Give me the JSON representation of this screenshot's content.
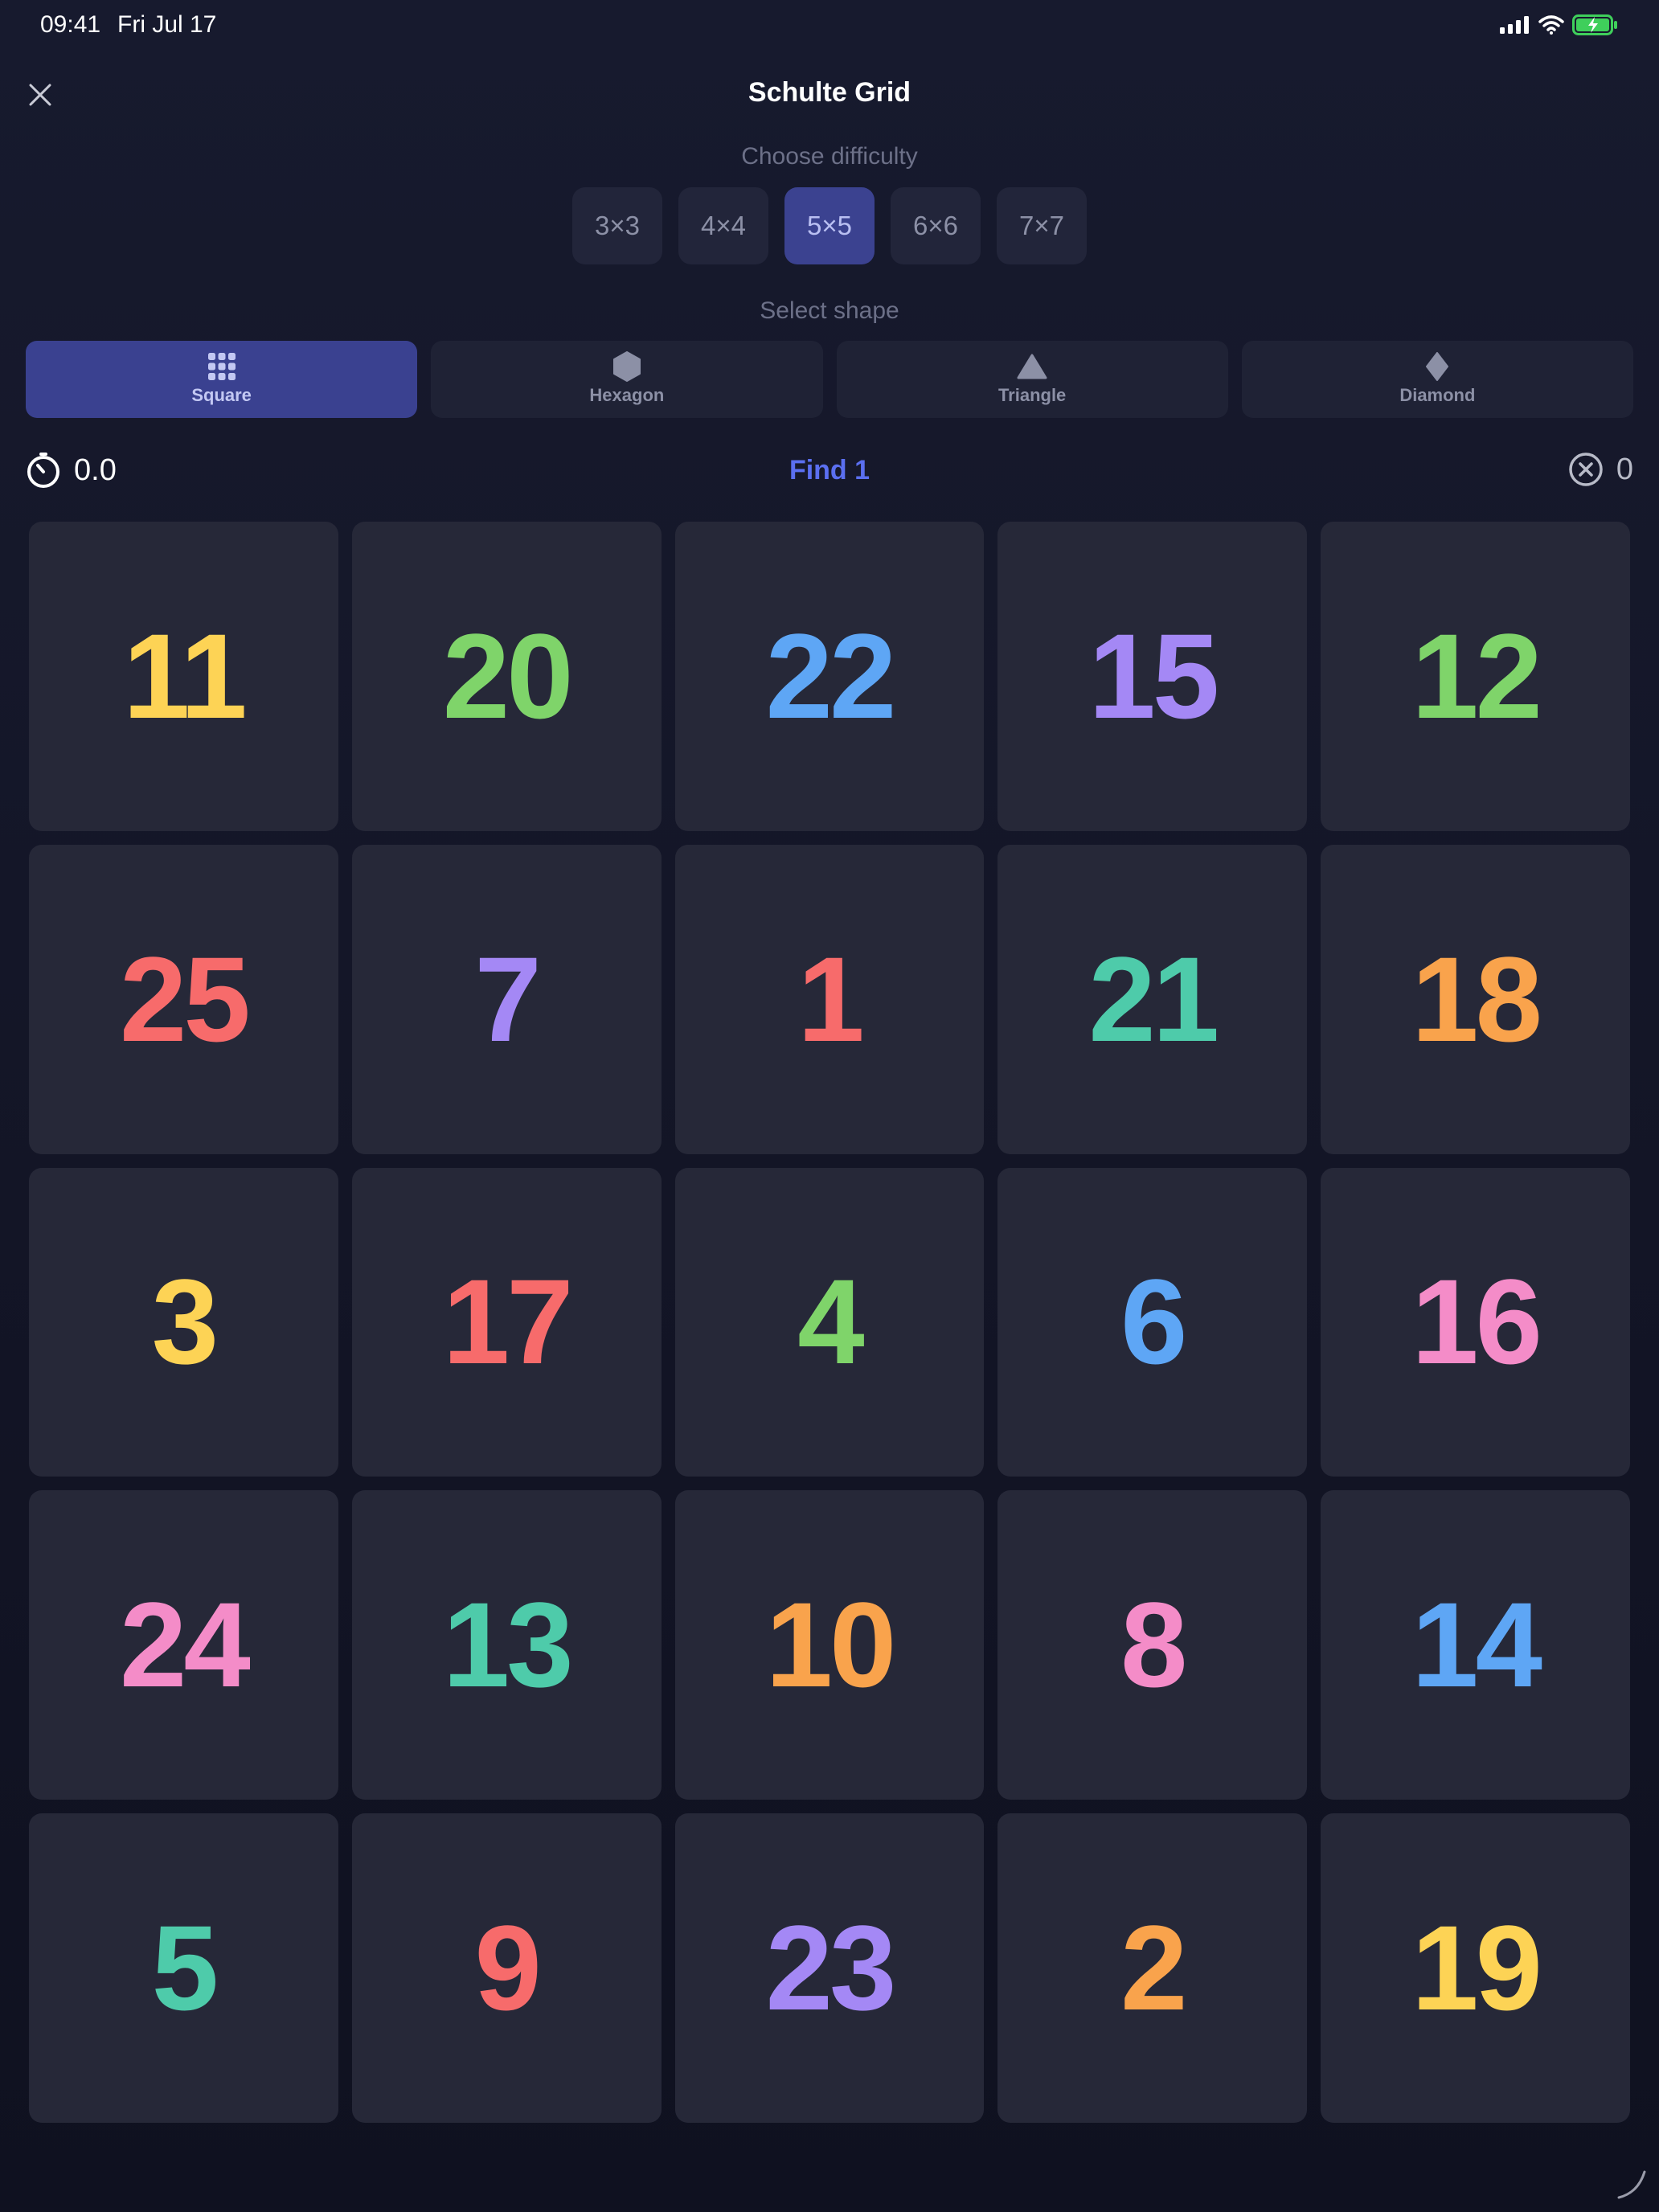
{
  "status_bar": {
    "time": "09:41",
    "date": "Fri Jul 17",
    "icons": [
      "cellular-signal-icon",
      "wifi-icon",
      "battery-charging-icon"
    ]
  },
  "header": {
    "title": "Schulte Grid",
    "close_icon": "close-icon"
  },
  "difficulty": {
    "label": "Choose difficulty",
    "options": [
      "3×3",
      "4×4",
      "5×5",
      "6×6",
      "7×7"
    ],
    "selected": "5×5"
  },
  "shape": {
    "label": "Select shape",
    "options": [
      {
        "label": "Square",
        "icon": "grid-icon"
      },
      {
        "label": "Hexagon",
        "icon": "hexagon-icon"
      },
      {
        "label": "Triangle",
        "icon": "triangle-icon"
      },
      {
        "label": "Diamond",
        "icon": "diamond-icon"
      }
    ],
    "selected": "Square"
  },
  "game": {
    "timer": "0.0",
    "find": "Find 1",
    "mistakes": "0",
    "cells": [
      {
        "n": "11",
        "color": "#fdd355"
      },
      {
        "n": "20",
        "color": "#7fd46a"
      },
      {
        "n": "22",
        "color": "#5ea6f5"
      },
      {
        "n": "15",
        "color": "#a488f5"
      },
      {
        "n": "12",
        "color": "#7fd46a"
      },
      {
        "n": "25",
        "color": "#f76b6b"
      },
      {
        "n": "7",
        "color": "#a488f5"
      },
      {
        "n": "1",
        "color": "#f76b6b"
      },
      {
        "n": "21",
        "color": "#4ecbaa"
      },
      {
        "n": "18",
        "color": "#f9a34c"
      },
      {
        "n": "3",
        "color": "#fdd355"
      },
      {
        "n": "17",
        "color": "#f76b6b"
      },
      {
        "n": "4",
        "color": "#7fd46a"
      },
      {
        "n": "6",
        "color": "#5ea6f5"
      },
      {
        "n": "16",
        "color": "#f48cc8"
      },
      {
        "n": "24",
        "color": "#f48cc8"
      },
      {
        "n": "13",
        "color": "#4ecbaa"
      },
      {
        "n": "10",
        "color": "#f9a34c"
      },
      {
        "n": "8",
        "color": "#f48cc8"
      },
      {
        "n": "14",
        "color": "#5ea6f5"
      },
      {
        "n": "5",
        "color": "#4ecbaa"
      },
      {
        "n": "9",
        "color": "#f76b6b"
      },
      {
        "n": "23",
        "color": "#a488f5"
      },
      {
        "n": "2",
        "color": "#f9a34c"
      },
      {
        "n": "19",
        "color": "#fdd355"
      }
    ]
  }
}
